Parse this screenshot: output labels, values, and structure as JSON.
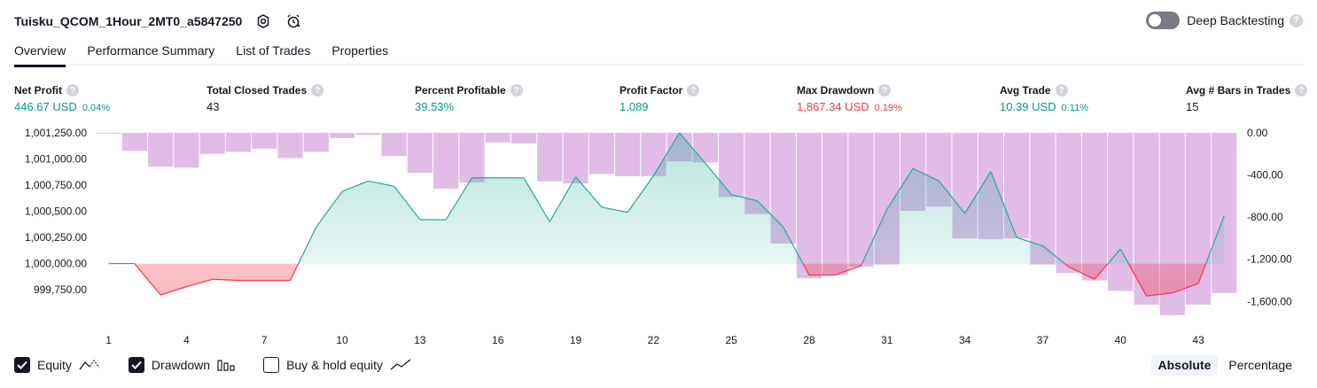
{
  "header": {
    "strategy_title": "Tuisku_QCOM_1Hour_2MT0_a5847250",
    "deep_backtesting_label": "Deep Backtesting",
    "deep_backtesting_on": false,
    "help_glyph": "?"
  },
  "tabs": [
    {
      "label": "Overview",
      "active": true
    },
    {
      "label": "Performance Summary",
      "active": false
    },
    {
      "label": "List of Trades",
      "active": false
    },
    {
      "label": "Properties",
      "active": false
    }
  ],
  "metrics": [
    {
      "label": "Net Profit",
      "value": "446.67 USD",
      "pct": "0.04%",
      "color": "#089981"
    },
    {
      "label": "Total Closed Trades",
      "value": "43",
      "pct": "",
      "color": "#131722"
    },
    {
      "label": "Percent Profitable",
      "value": "39.53%",
      "pct": "",
      "color": "#089981"
    },
    {
      "label": "Profit Factor",
      "value": "1.089",
      "pct": "",
      "color": "#089981"
    },
    {
      "label": "Max Drawdown",
      "value": "1,867.34 USD",
      "pct": "0.19%",
      "color": "#f23645"
    },
    {
      "label": "Avg Trade",
      "value": "10.39 USD",
      "pct": "0.11%",
      "color": "#089981"
    },
    {
      "label": "Avg # Bars in Trades",
      "value": "15",
      "pct": "",
      "color": "#131722"
    }
  ],
  "chart_data": {
    "type": "line",
    "x_ticks": [
      1,
      4,
      7,
      10,
      13,
      16,
      19,
      22,
      25,
      28,
      31,
      34,
      37,
      40,
      43
    ],
    "left_axis": {
      "ticks": [
        "1,001,250.00",
        "1,001,000.00",
        "1,000,750.00",
        "1,000,500.00",
        "1,000,250.00",
        "1,000,000.00",
        "999,750.00"
      ],
      "ylim": [
        999700,
        1001250
      ],
      "baseline": 1000000
    },
    "right_axis": {
      "ticks": [
        "0.00",
        "-400.00",
        "-800.00",
        "-1,200.00",
        "-1,600.00"
      ],
      "ylim": [
        -1900,
        0
      ]
    },
    "series": [
      {
        "name": "Equity",
        "x": [
          1,
          2,
          3,
          4,
          5,
          6,
          7,
          8,
          9,
          10,
          11,
          12,
          13,
          14,
          15,
          16,
          17,
          18,
          19,
          20,
          21,
          22,
          23,
          24,
          25,
          26,
          27,
          28,
          29,
          30,
          31,
          32,
          33,
          34,
          35,
          36,
          37,
          38,
          39,
          40,
          41,
          42,
          43,
          44
        ],
        "values": [
          1000000,
          1000000,
          999700,
          999780,
          999850,
          999840,
          999840,
          999840,
          1000350,
          1000690,
          1000790,
          1000740,
          1000420,
          1000420,
          1000820,
          1000820,
          1000820,
          1000400,
          1000830,
          1000540,
          1000490,
          1000840,
          1001250,
          1000960,
          1000660,
          1000600,
          1000350,
          999890,
          999890,
          999980,
          1000520,
          1000910,
          1000790,
          1000480,
          1000880,
          1000250,
          1000170,
          999970,
          999850,
          1000140,
          999690,
          999720,
          999810,
          1000460
        ]
      },
      {
        "name": "Drawdown",
        "x": [
          1,
          2,
          3,
          4,
          5,
          6,
          7,
          8,
          9,
          10,
          11,
          12,
          13,
          14,
          15,
          16,
          17,
          18,
          19,
          20,
          21,
          22,
          23,
          24,
          25,
          26,
          27,
          28,
          29,
          30,
          31,
          32,
          33,
          34,
          35,
          36,
          37,
          38,
          39,
          40,
          41,
          42,
          43,
          44
        ],
        "values": [
          0,
          -170,
          -320,
          -330,
          -200,
          -180,
          -150,
          -240,
          -180,
          -50,
          -20,
          -220,
          -380,
          -530,
          -470,
          -90,
          -100,
          -460,
          -480,
          -390,
          -410,
          -410,
          -270,
          -280,
          -610,
          -770,
          -1050,
          -1380,
          -1350,
          -1270,
          -1250,
          -740,
          -700,
          -1000,
          -1010,
          -1000,
          -1250,
          -1330,
          -1400,
          -1500,
          -1630,
          -1730,
          -1630,
          -1520
        ]
      }
    ],
    "colors": {
      "equity_up": "#22ab94",
      "equity_down": "#f23645",
      "drawdown": "#ce93d8"
    }
  },
  "legend": [
    {
      "label": "Equity",
      "checked": true,
      "icon": "equity-line-icon"
    },
    {
      "label": "Drawdown",
      "checked": true,
      "icon": "drawdown-bars-icon"
    },
    {
      "label": "Buy & hold equity",
      "checked": false,
      "icon": "buy-hold-line-icon"
    }
  ],
  "view_modes": [
    {
      "label": "Absolute",
      "active": true
    },
    {
      "label": "Percentage",
      "active": false
    }
  ]
}
